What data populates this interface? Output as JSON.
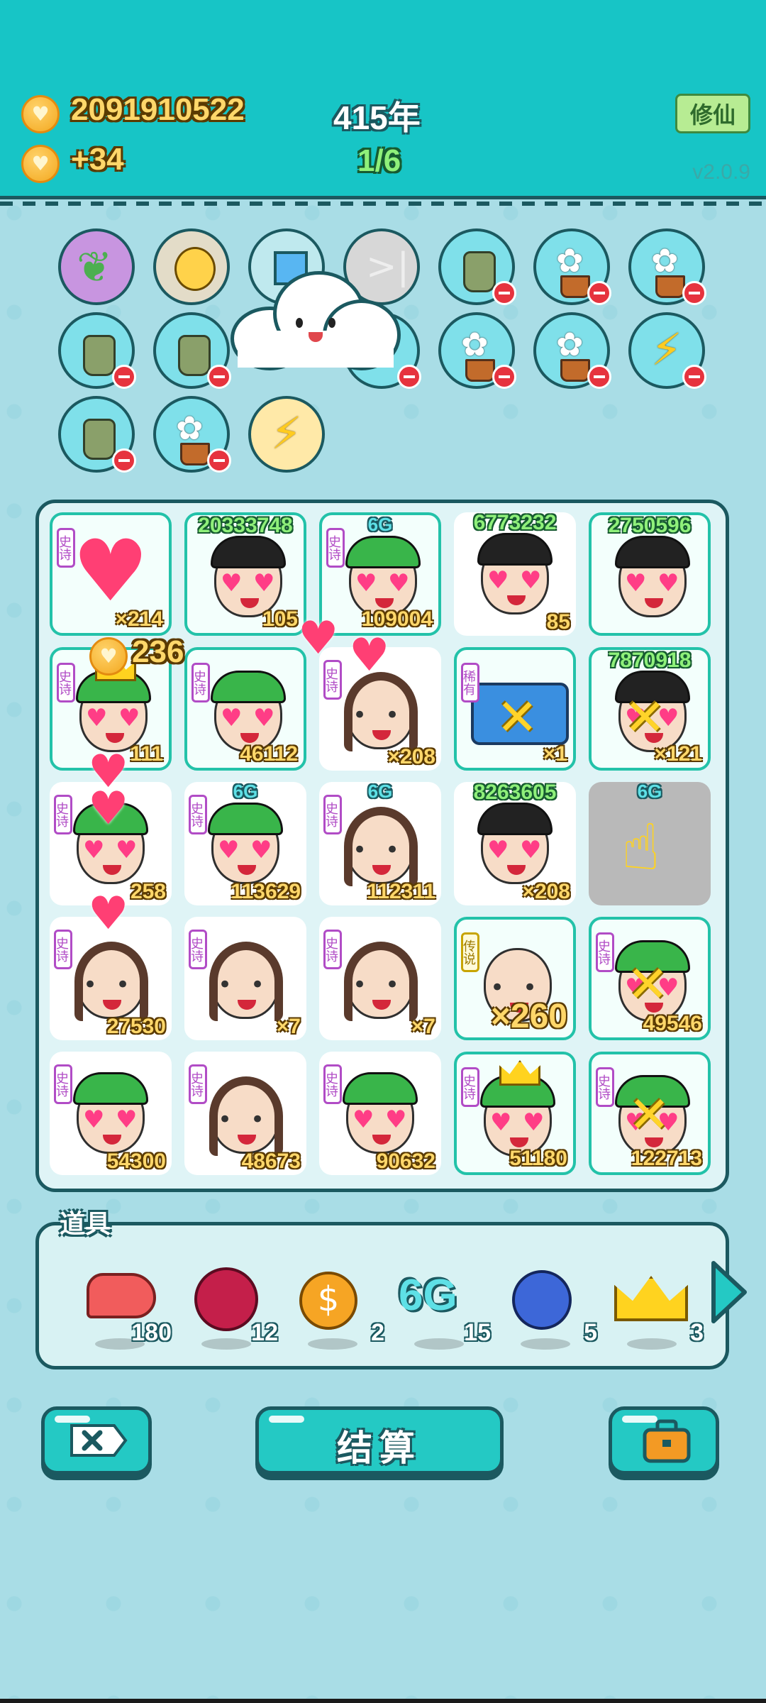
{
  "header": {
    "coins": "2091910522",
    "income": "+34",
    "year": "415年",
    "progress": "1/6",
    "xiuxian_label": "修仙",
    "version": "v2.0.9"
  },
  "board_tiles": [
    {
      "top": "",
      "count": "×214",
      "badge": "史诗"
    },
    {
      "top": "20333748",
      "count": "105",
      "badge": ""
    },
    {
      "top": "6G",
      "count": "109004",
      "badge": "史诗"
    },
    {
      "top": "6773232",
      "count": "85",
      "badge": ""
    },
    {
      "top": "2750596",
      "count": "",
      "badge": ""
    },
    {
      "top": "",
      "count": "111",
      "badge": "史诗"
    },
    {
      "top": "",
      "count": "46112",
      "badge": "史诗"
    },
    {
      "top": "",
      "count": "×208",
      "badge": "史诗"
    },
    {
      "top": "",
      "count": "×1",
      "badge": "稀有"
    },
    {
      "top": "7870918",
      "count": "×121",
      "badge": ""
    },
    {
      "top": "",
      "count": "258",
      "badge": "史诗"
    },
    {
      "top": "6G",
      "count": "113629",
      "badge": "史诗"
    },
    {
      "top": "6G",
      "count": "112311",
      "badge": "史诗"
    },
    {
      "top": "8263605",
      "count": "×208",
      "badge": ""
    },
    {
      "top": "6G",
      "count": "",
      "badge": ""
    },
    {
      "top": "",
      "count": "27530",
      "badge": "史诗"
    },
    {
      "top": "",
      "count": "×7",
      "badge": "史诗"
    },
    {
      "top": "",
      "count": "×7",
      "badge": "史诗"
    },
    {
      "top": "",
      "count": "×260",
      "badge": "传说"
    },
    {
      "top": "",
      "count": "49546",
      "badge": "史诗"
    },
    {
      "top": "",
      "count": "54300",
      "badge": "史诗"
    },
    {
      "top": "",
      "count": "48673",
      "badge": "史诗"
    },
    {
      "top": "",
      "count": "90632",
      "badge": "史诗"
    },
    {
      "top": "",
      "count": "51180",
      "badge": "史诗"
    },
    {
      "top": "",
      "count": "122713",
      "badge": "史诗"
    }
  ],
  "floating_bonus": "236",
  "items": {
    "title": "道具",
    "list": [
      {
        "icon": "liver-icon",
        "count": "180"
      },
      {
        "icon": "bayberry-icon",
        "count": "12"
      },
      {
        "icon": "dollar-coin-icon",
        "count": "2"
      },
      {
        "icon": "6g-icon",
        "label": "6G",
        "count": "15"
      },
      {
        "icon": "blueberry-icon",
        "count": "5"
      },
      {
        "icon": "crown-icon",
        "count": "3"
      }
    ]
  },
  "buttons": {
    "settle_label": "结算"
  },
  "colors": {
    "header": "#17c5c6",
    "outline": "#1b5960",
    "gold": "#ffd76a",
    "green": "#8ff07a"
  }
}
